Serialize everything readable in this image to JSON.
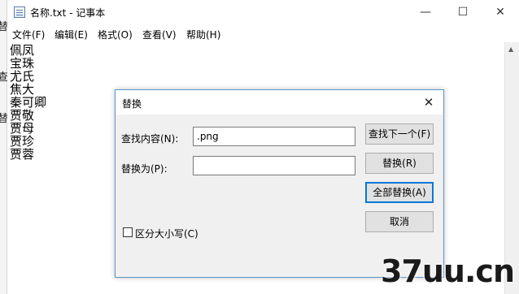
{
  "background_strip": {
    "chars": [
      "替",
      "查",
      "替"
    ]
  },
  "window": {
    "title": "名称.txt - 记事本",
    "icon": "notepad-icon",
    "minimize_glyph": "—",
    "maximize_glyph": "☐",
    "close_glyph": "✕"
  },
  "menubar": {
    "items": [
      {
        "label": "文件(F)"
      },
      {
        "label": "编辑(E)"
      },
      {
        "label": "格式(O)"
      },
      {
        "label": "查看(V)"
      },
      {
        "label": "帮助(H)"
      }
    ]
  },
  "editor": {
    "lines": [
      "佩凤",
      "宝珠",
      "尤氏",
      "焦大",
      "秦可卿",
      "贾敬",
      "贾母",
      "贾珍",
      "贾蓉"
    ]
  },
  "dialog": {
    "title": "替换",
    "close_glyph": "✕",
    "find_label": "查找内容(N):",
    "find_value": ".png",
    "replace_label": "替换为(P):",
    "replace_value": "",
    "find_next_button": "查找下一个(F)",
    "replace_button": "替换(R)",
    "replace_all_button": "全部替换(A)",
    "cancel_button": "取消",
    "match_case_label": "区分大小写(C)",
    "match_case_checked": false
  },
  "watermark": {
    "text": "37uu.cn"
  }
}
